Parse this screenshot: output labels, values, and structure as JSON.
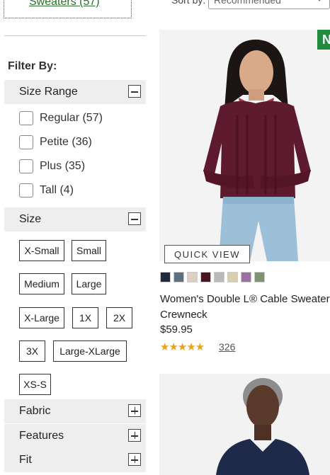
{
  "category": {
    "label": "Sweaters (57)"
  },
  "sort": {
    "label": "Sort by:",
    "value": "Recommended"
  },
  "filter": {
    "heading": "Filter By:",
    "size_range": {
      "title": "Size Range",
      "options": [
        "Regular (57)",
        "Petite (36)",
        "Plus (35)",
        "Tall (4)"
      ]
    },
    "size": {
      "title": "Size",
      "options": [
        "X-Small",
        "Small",
        "Medium",
        "Large",
        "X-Large",
        "1X",
        "2X",
        "3X",
        "Large-XLarge",
        "XS-S"
      ]
    },
    "fabric": {
      "title": "Fabric"
    },
    "features": {
      "title": "Features"
    },
    "fit": {
      "title": "Fit"
    }
  },
  "product": {
    "badge": "N",
    "quick_view": "QUICK VIEW",
    "name_line1": "Women's Double L® Cable Sweater,",
    "name_line2": "Crewneck",
    "price": "$59.95",
    "rating": 4.5,
    "stars": "★★★★★",
    "reviews": "326",
    "swatch_colors": [
      "#1f2a3d",
      "#5d6f80",
      "#e0cfc0",
      "#4a1422",
      "#b7b9bb",
      "#d8cfae",
      "#9b6fa5",
      "#7f9274"
    ]
  }
}
